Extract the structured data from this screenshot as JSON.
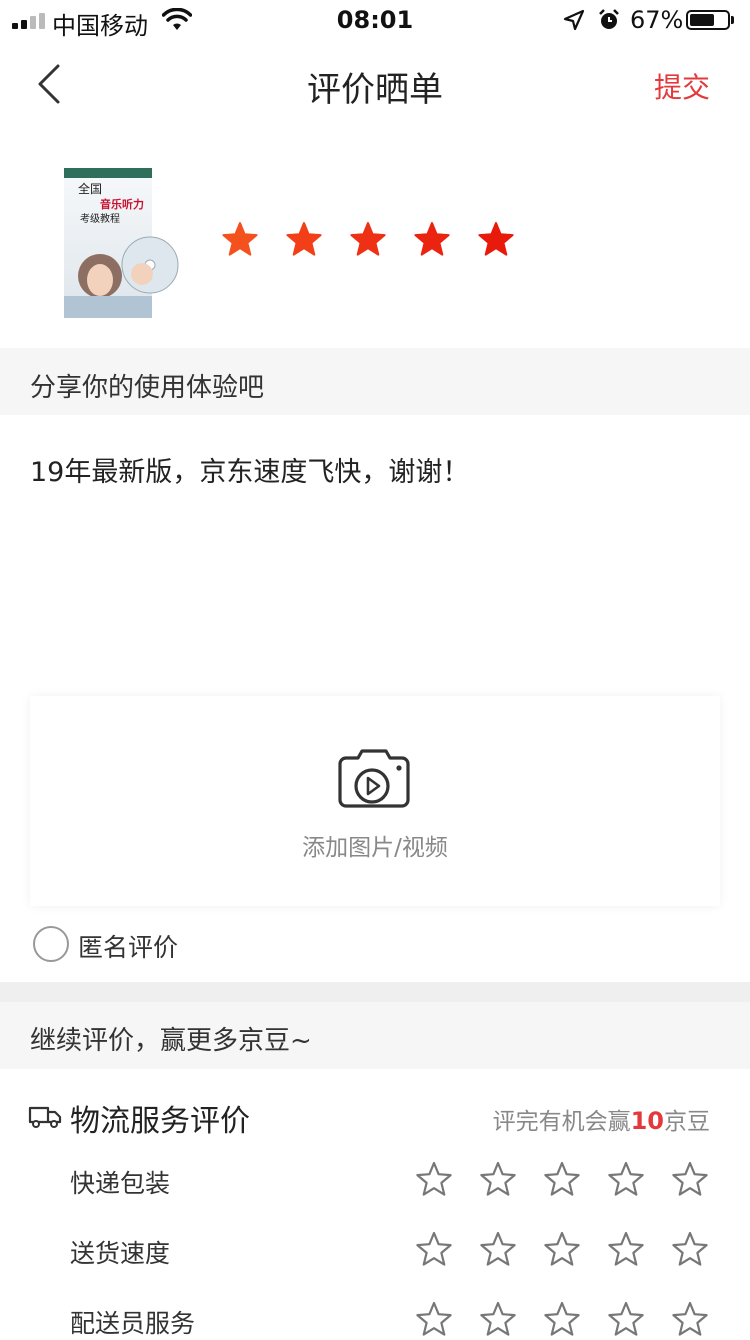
{
  "status_bar": {
    "carrier": "中国移动",
    "time": "08:01",
    "battery": "67%",
    "battery_level": 0.67
  },
  "nav": {
    "title": "评价晒单",
    "submit": "提交"
  },
  "product": {
    "cover": {
      "line1": "全国",
      "line2": "音乐听力",
      "line3": "考级教程"
    },
    "rating": 5,
    "rating_max": 5,
    "star_colors": [
      "#f4511e",
      "#f23f18",
      "#ee3014",
      "#ea2410",
      "#e81a0c"
    ]
  },
  "review": {
    "section_label": "分享你的使用体验吧",
    "text": "19年最新版，京东速度飞快，谢谢！"
  },
  "upload": {
    "label": "添加图片/视频"
  },
  "anonymous": {
    "label": "匿名评价",
    "checked": false
  },
  "more": {
    "label": "继续评价，赢更多京豆~"
  },
  "logistics": {
    "title": "物流服务评价",
    "reward_prefix": "评完有机会赢",
    "reward_amount": "10",
    "reward_suffix": "京豆",
    "rows": [
      {
        "label": "快递包装",
        "rating": 0
      },
      {
        "label": "送货速度",
        "rating": 0
      },
      {
        "label": "配送员服务",
        "rating": 0
      }
    ]
  },
  "colors": {
    "accent": "#e4393c",
    "band": "#f6f6f6"
  }
}
